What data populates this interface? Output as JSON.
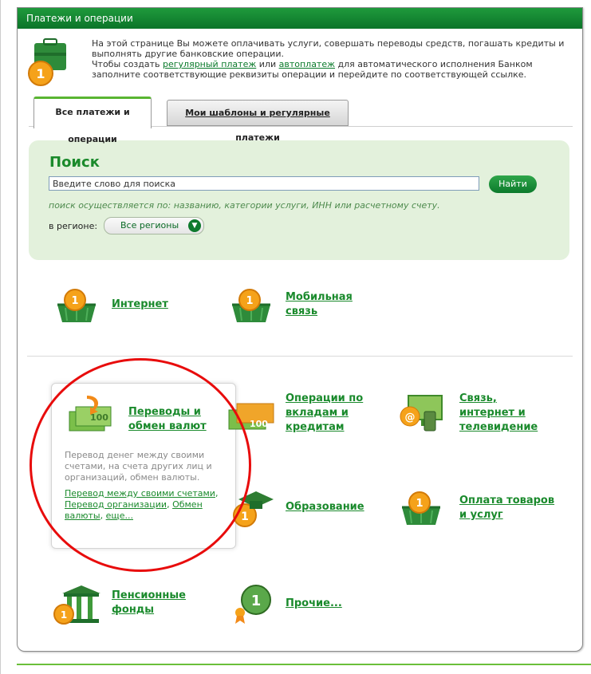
{
  "header": {
    "title": "Платежи и операции"
  },
  "intro": {
    "line1": "На этой странице Вы можете оплачивать услуги, совершать переводы средств, погашать кредиты и выполнять другие банковские операции.",
    "line2_prefix": "Чтобы создать",
    "regular_link": "регулярный платеж",
    "or": "или",
    "auto_link": "автоплатеж",
    "line2_suffix": "для автоматического исполнения Банком заполните соответствующие реквизиты операции и перейдите по соответствующей ссылке."
  },
  "tabs": {
    "active": "Все платежи и операции",
    "inactive": "Мои шаблоны и регулярные платежи"
  },
  "search": {
    "title": "Поиск",
    "placeholder": "Введите слово для поиска",
    "button": "Найти",
    "hint": "поиск осуществляется по: названию, категории услуги, ИНН или расчетному счету.",
    "region_label": "в регионе:",
    "region_value": "Все регионы"
  },
  "categories": {
    "internet": "Интернет",
    "mobile_1": "Мобильная",
    "mobile_2": "связь",
    "transfers_1": "Переводы и",
    "transfers_2": "обмен валют",
    "deposits_1": "Операции по",
    "deposits_2": "вкладам и",
    "deposits_3": "кредитам",
    "comm_1": "Связь,",
    "comm_2": "интернет и",
    "comm_3": "телевидение",
    "education": "Образование",
    "goods_1": "Оплата товаров",
    "goods_2": "и услуг",
    "pension_1": "Пенсионные",
    "pension_2": "фонды",
    "other": "Прочие..."
  },
  "transfers_card": {
    "description": "Перевод денег между своими счетами, на счета других лиц и организаций, обмен валюты.",
    "link1": "Перевод между своими счетами",
    "link2": "Перевод организации",
    "link3": "Обмен валюты",
    "link4": "еще..."
  },
  "colors": {
    "brand_green": "#0b7429",
    "link_green": "#1a8a2c",
    "search_bg": "#e3f1dc",
    "highlight_red": "#e80c0c"
  }
}
